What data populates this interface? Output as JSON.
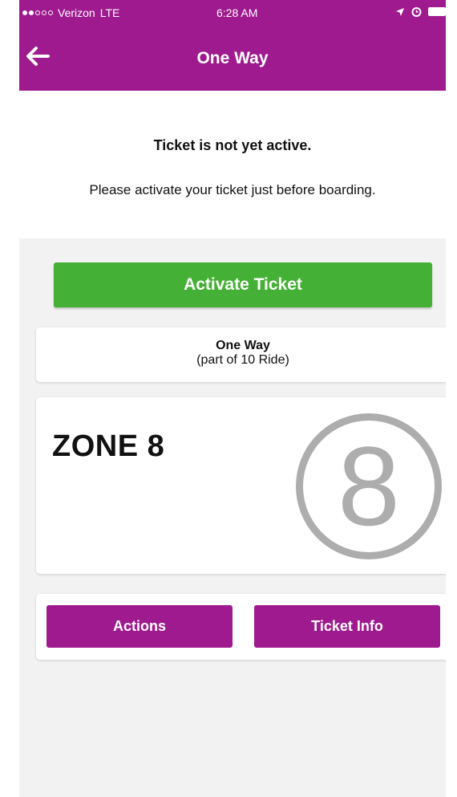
{
  "status_bar": {
    "carrier": "Verizon",
    "network": "LTE",
    "time": "6:28 AM",
    "icons": [
      "signal-dots-icon",
      "location-arrow-icon",
      "alarm-icon",
      "battery-icon"
    ]
  },
  "nav": {
    "title": "One Way",
    "back_icon": "back-arrow-icon"
  },
  "message": {
    "title": "Ticket is not yet active.",
    "subtitle": "Please activate your ticket just before boarding."
  },
  "activate_button": "Activate Ticket",
  "ticket_type": {
    "name": "One Way",
    "sub": "(part of 10 Ride)"
  },
  "zone": {
    "label": "ZONE 8",
    "badge": "8"
  },
  "actions": {
    "actions_label": "Actions",
    "ticket_info_label": "Ticket Info"
  },
  "colors": {
    "brand": "#9e1a8e",
    "activate": "#44b035",
    "badge": "#adadad"
  }
}
